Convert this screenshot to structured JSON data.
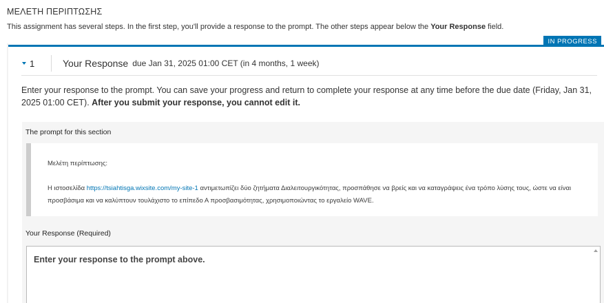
{
  "page": {
    "title": "ΜΕΛΕΤΗ ΠΕΡΙΠΤΩΣΗΣ",
    "intro_prefix": "This assignment has several steps. In the first step, you'll provide a response to the prompt. The other steps appear below the ",
    "intro_bold": "Your Response",
    "intro_suffix": " field."
  },
  "status": {
    "label": "IN PROGRESS",
    "color": "#0075b4"
  },
  "step": {
    "toggle_icon": "caret-down-icon",
    "number": "1",
    "title": "Your Response",
    "due": "due Jan 31, 2025 01:00 CET (in 4 months, 1 week)"
  },
  "instructions": {
    "text": "Enter your response to the prompt. You can save your progress and return to complete your response at any time before the due date (Friday, Jan 31, 2025 01:00 CET). ",
    "bold": "After you submit your response, you cannot edit it."
  },
  "prompt": {
    "label": "The prompt for this section",
    "line1": "Μελέτη περίπτωσης:",
    "line2_prefix": "Η ιστοσελίδα ",
    "link_text": "https://tsiahtisga.wixsite.com/my-site-1",
    "line2_suffix": " αντιμετωπίζει δύο ζητήματα Διαλειτουργικότητας, προσπάθησε να βρείς και να καταγράψεις ένα τρόπο λύσης τους, ώστε να είναι προσβάσιμα και να καλύπτουν τουλάχιστο το επίπεδο Α προσβασιμότητας, χρησιμοποιώντας το εργαλείο WAVE."
  },
  "response": {
    "label": "Your Response (Required)",
    "placeholder": "Enter your response to the prompt above."
  },
  "colors": {
    "accent": "#0075b4",
    "section_bg": "#f5f5f5"
  }
}
